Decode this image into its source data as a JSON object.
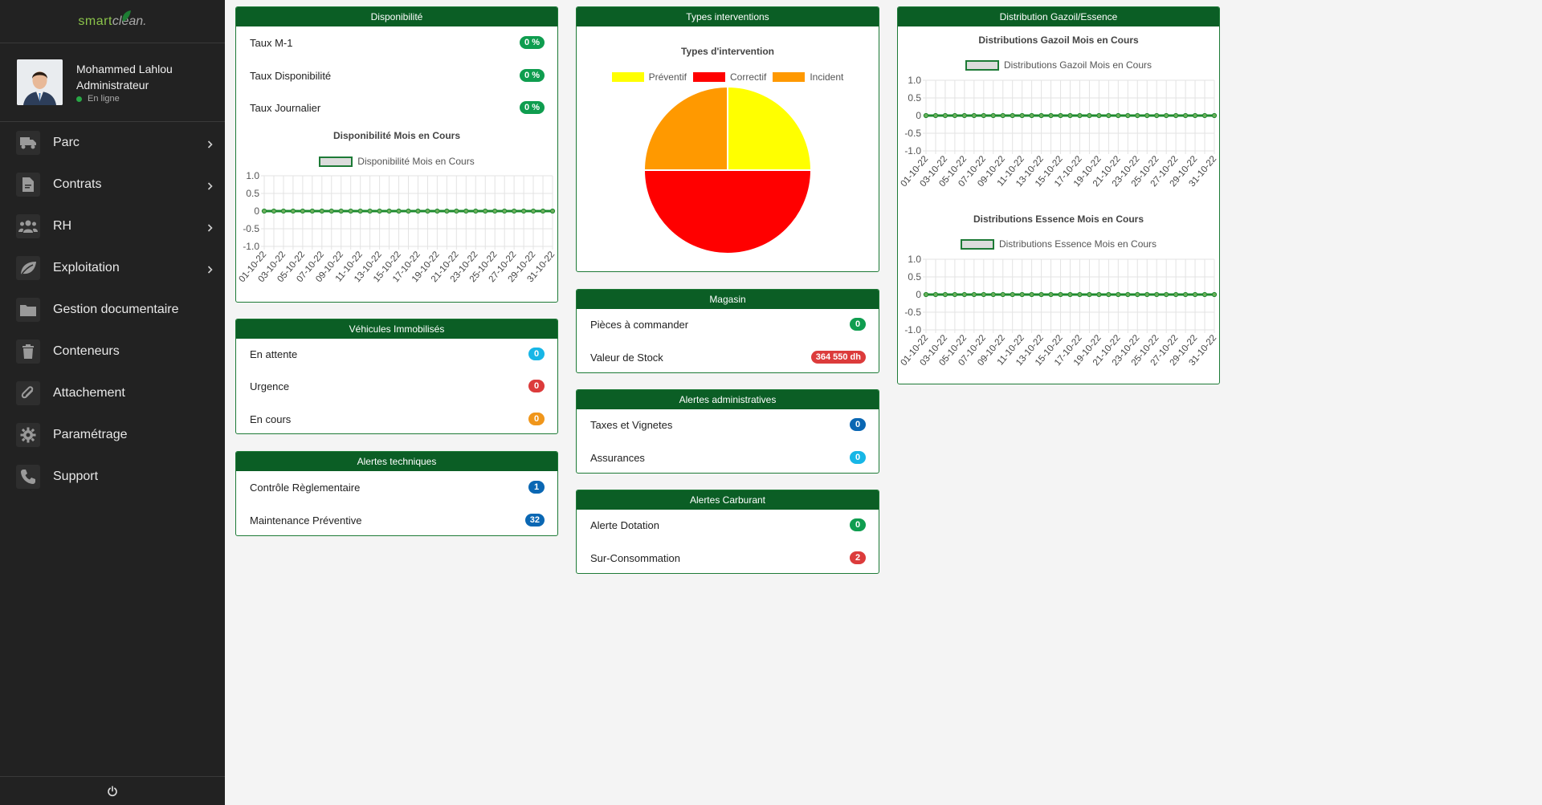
{
  "app": {
    "logo_a": "smart",
    "logo_b": "clean."
  },
  "user": {
    "name": "Mohammed Lahlou",
    "role": "Administrateur",
    "status": "En ligne"
  },
  "nav": [
    {
      "label": "Parc",
      "icon": "truck-icon",
      "has_submenu": true
    },
    {
      "label": "Contrats",
      "icon": "document-icon",
      "has_submenu": true
    },
    {
      "label": "RH",
      "icon": "users-icon",
      "has_submenu": true
    },
    {
      "label": "Exploitation",
      "icon": "leaf-icon",
      "has_submenu": true
    },
    {
      "label": "Gestion documentaire",
      "icon": "folder-icon",
      "has_submenu": false
    },
    {
      "label": "Conteneurs",
      "icon": "trash-icon",
      "has_submenu": false
    },
    {
      "label": "Attachement",
      "icon": "paperclip-icon",
      "has_submenu": false
    },
    {
      "label": "Paramétrage",
      "icon": "gear-icon",
      "has_submenu": false
    },
    {
      "label": "Support",
      "icon": "phone-icon",
      "has_submenu": false
    }
  ],
  "colors": {
    "header": "#0b5e25",
    "border": "#1d7a36",
    "line": "#1d8a2e"
  },
  "disponibilite": {
    "title": "Disponibilité",
    "rows": [
      {
        "label": "Taux M-1",
        "value": "0 %"
      },
      {
        "label": "Taux Disponibilité",
        "value": "0 %"
      },
      {
        "label": "Taux Journalier",
        "value": "0 %"
      }
    ]
  },
  "vehicules": {
    "title": "Véhicules Immobilisés",
    "rows": [
      {
        "label": "En attente",
        "value": "0"
      },
      {
        "label": "Urgence",
        "value": "0"
      },
      {
        "label": "En cours",
        "value": "0"
      }
    ]
  },
  "alertes_tech": {
    "title": "Alertes techniques",
    "rows": [
      {
        "label": "Contrôle Règlementaire",
        "value": "1"
      },
      {
        "label": "Maintenance Préventive",
        "value": "32"
      }
    ]
  },
  "types": {
    "title": "Types interventions"
  },
  "magasin": {
    "title": "Magasin",
    "rows": [
      {
        "label": "Pièces à commander",
        "value": "0"
      },
      {
        "label": "Valeur de Stock",
        "value": "364 550 dh"
      }
    ]
  },
  "alertes_admin": {
    "title": "Alertes administratives",
    "rows": [
      {
        "label": "Taxes et Vignetes",
        "value": "0"
      },
      {
        "label": "Assurances",
        "value": "0"
      }
    ]
  },
  "alertes_carb": {
    "title": "Alertes Carburant",
    "rows": [
      {
        "label": "Alerte Dotation",
        "value": "0"
      },
      {
        "label": "Sur-Consommation",
        "value": "2"
      }
    ]
  },
  "distribution": {
    "title": "Distribution Gazoil/Essence"
  },
  "chart_data": [
    {
      "id": "dispo",
      "type": "line",
      "title": "Disponibilité Mois en Cours",
      "series": [
        {
          "name": "Disponibilité Mois en Cours",
          "values": [
            0,
            0,
            0,
            0,
            0,
            0,
            0,
            0,
            0,
            0,
            0,
            0,
            0,
            0,
            0,
            0,
            0,
            0,
            0,
            0,
            0,
            0,
            0,
            0,
            0,
            0,
            0,
            0,
            0,
            0,
            0
          ]
        }
      ],
      "x": [
        "01-10-22",
        "02-10-22",
        "03-10-22",
        "04-10-22",
        "05-10-22",
        "06-10-22",
        "07-10-22",
        "08-10-22",
        "09-10-22",
        "10-10-22",
        "11-10-22",
        "12-10-22",
        "13-10-22",
        "14-10-22",
        "15-10-22",
        "16-10-22",
        "17-10-22",
        "18-10-22",
        "19-10-22",
        "20-10-22",
        "21-10-22",
        "22-10-22",
        "23-10-22",
        "24-10-22",
        "25-10-22",
        "26-10-22",
        "27-10-22",
        "28-10-22",
        "29-10-22",
        "30-10-22",
        "31-10-22"
      ],
      "x_tick_labels": [
        "01-10-22",
        "03-10-22",
        "05-10-22",
        "07-10-22",
        "09-10-22",
        "11-10-22",
        "13-10-22",
        "15-10-22",
        "17-10-22",
        "19-10-22",
        "21-10-22",
        "23-10-22",
        "25-10-22",
        "27-10-22",
        "29-10-22",
        "31-10-22"
      ],
      "y_ticks": [
        "1.0",
        "0.5",
        "0",
        "-0.5",
        "-1.0"
      ],
      "ylim": [
        -1,
        1
      ],
      "grid": true,
      "legend": "top"
    },
    {
      "id": "pie",
      "type": "pie",
      "title": "Types d'intervention",
      "categories": [
        "Préventif",
        "Correctif",
        "Incident"
      ],
      "values": [
        1,
        2,
        1
      ],
      "colors": [
        "#ffff00",
        "#ff0000",
        "#ff9900"
      ],
      "legend": "top"
    },
    {
      "id": "gazoil",
      "type": "line",
      "title": "Distributions Gazoil Mois en Cours",
      "series": [
        {
          "name": "Distributions Gazoil Mois en Cours",
          "values": [
            0,
            0,
            0,
            0,
            0,
            0,
            0,
            0,
            0,
            0,
            0,
            0,
            0,
            0,
            0,
            0,
            0,
            0,
            0,
            0,
            0,
            0,
            0,
            0,
            0,
            0,
            0,
            0,
            0,
            0,
            0
          ]
        }
      ],
      "x_tick_labels": [
        "01-10-22",
        "03-10-22",
        "05-10-22",
        "07-10-22",
        "09-10-22",
        "11-10-22",
        "13-10-22",
        "15-10-22",
        "17-10-22",
        "19-10-22",
        "21-10-22",
        "23-10-22",
        "25-10-22",
        "27-10-22",
        "29-10-22",
        "31-10-22"
      ],
      "y_ticks": [
        "1.0",
        "0.5",
        "0",
        "-0.5",
        "-1.0"
      ],
      "ylim": [
        -1,
        1
      ],
      "grid": true,
      "legend": "top"
    },
    {
      "id": "essence",
      "type": "line",
      "title": "Distributions Essence Mois en Cours",
      "series": [
        {
          "name": "Distributions Essence Mois en Cours",
          "values": [
            0,
            0,
            0,
            0,
            0,
            0,
            0,
            0,
            0,
            0,
            0,
            0,
            0,
            0,
            0,
            0,
            0,
            0,
            0,
            0,
            0,
            0,
            0,
            0,
            0,
            0,
            0,
            0,
            0,
            0,
            0
          ]
        }
      ],
      "x_tick_labels": [
        "01-10-22",
        "03-10-22",
        "05-10-22",
        "07-10-22",
        "09-10-22",
        "11-10-22",
        "13-10-22",
        "15-10-22",
        "17-10-22",
        "19-10-22",
        "21-10-22",
        "23-10-22",
        "25-10-22",
        "27-10-22",
        "29-10-22",
        "31-10-22"
      ],
      "y_ticks": [
        "1.0",
        "0.5",
        "0",
        "-0.5",
        "-1.0"
      ],
      "ylim": [
        -1,
        1
      ],
      "grid": true,
      "legend": "top"
    }
  ]
}
